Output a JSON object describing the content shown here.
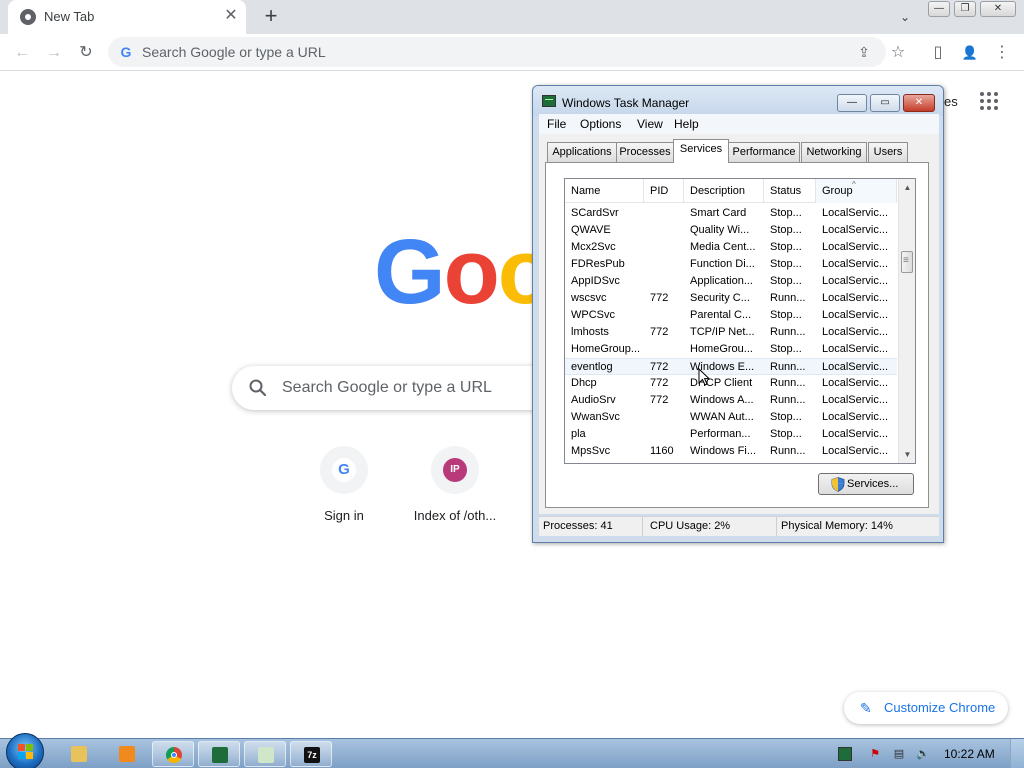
{
  "browser": {
    "tab": {
      "title": "New Tab",
      "close": "✕"
    },
    "new_tab": "+",
    "tab_search": "⌄",
    "window_controls": {
      "minimize": "—",
      "maximize": "❐",
      "close": "✕"
    },
    "nav": {
      "back": "←",
      "forward": "→",
      "reload": "↻"
    },
    "omnibox": {
      "placeholder": "Search Google or type a URL",
      "value": ""
    },
    "toolbar_icons": {
      "share": "⇪",
      "bookmark": "☆",
      "side_panel": "▯",
      "profile": "👤",
      "menu": "⋮"
    }
  },
  "ntp": {
    "logo_visible": [
      "G",
      "o",
      "o"
    ],
    "search": {
      "placeholder": "Search Google or type a URL",
      "value": ""
    },
    "shortcuts": [
      {
        "label": "Sign in",
        "icon": "G",
        "icon_name": "google-icon"
      },
      {
        "label": "Index of /oth...",
        "icon": "IP",
        "icon_name": "ip-icon"
      }
    ],
    "top_link_partial": "es",
    "customize_label": "Customize Chrome"
  },
  "task_manager": {
    "title": "Windows Task Manager",
    "controls": {
      "minimize": "—",
      "maximize": "▭",
      "close": "✕"
    },
    "menu": [
      "File",
      "Options",
      "View",
      "Help"
    ],
    "tabs": [
      "Applications",
      "Processes",
      "Services",
      "Performance",
      "Networking",
      "Users"
    ],
    "active_tab": "Services",
    "columns": [
      "Name",
      "PID",
      "Description",
      "Status",
      "Group"
    ],
    "sorted_column": "Group",
    "rows": [
      {
        "name": "SCardSvr",
        "pid": "",
        "description": "Smart Card",
        "status": "Stop...",
        "group": "LocalServic..."
      },
      {
        "name": "QWAVE",
        "pid": "",
        "description": "Quality Wi...",
        "status": "Stop...",
        "group": "LocalServic..."
      },
      {
        "name": "Mcx2Svc",
        "pid": "",
        "description": "Media Cent...",
        "status": "Stop...",
        "group": "LocalServic..."
      },
      {
        "name": "FDResPub",
        "pid": "",
        "description": "Function Di...",
        "status": "Stop...",
        "group": "LocalServic..."
      },
      {
        "name": "AppIDSvc",
        "pid": "",
        "description": "Application...",
        "status": "Stop...",
        "group": "LocalServic..."
      },
      {
        "name": "wscsvc",
        "pid": "772",
        "description": "Security C...",
        "status": "Runn...",
        "group": "LocalServic..."
      },
      {
        "name": "WPCSvc",
        "pid": "",
        "description": "Parental C...",
        "status": "Stop...",
        "group": "LocalServic..."
      },
      {
        "name": "lmhosts",
        "pid": "772",
        "description": "TCP/IP Net...",
        "status": "Runn...",
        "group": "LocalServic..."
      },
      {
        "name": "HomeGroup...",
        "pid": "",
        "description": "HomeGrou...",
        "status": "Stop...",
        "group": "LocalServic..."
      },
      {
        "name": "eventlog",
        "pid": "772",
        "description": "Windows E...",
        "status": "Runn...",
        "group": "LocalServic..."
      },
      {
        "name": "Dhcp",
        "pid": "772",
        "description": "DHCP Client",
        "status": "Runn...",
        "group": "LocalServic..."
      },
      {
        "name": "AudioSrv",
        "pid": "772",
        "description": "Windows A...",
        "status": "Runn...",
        "group": "LocalServic..."
      },
      {
        "name": "WwanSvc",
        "pid": "",
        "description": "WWAN Aut...",
        "status": "Stop...",
        "group": "LocalServic..."
      },
      {
        "name": "pla",
        "pid": "",
        "description": "Performan...",
        "status": "Stop...",
        "group": "LocalServic..."
      },
      {
        "name": "MpsSvc",
        "pid": "1160",
        "description": "Windows Fi...",
        "status": "Runn...",
        "group": "LocalServic..."
      }
    ],
    "hovered_row": "eventlog",
    "services_button": "Services...",
    "status_bar": {
      "processes": "Processes: 41",
      "cpu": "CPU Usage: 2%",
      "memory": "Physical Memory: 14%"
    }
  },
  "taskbar": {
    "clock": "10:22 AM",
    "apps": [
      {
        "name": "explorer",
        "icon_name": "folder-icon",
        "color": "#e8c25a"
      },
      {
        "name": "media-player",
        "icon_name": "media-player-icon",
        "color": "#f08a1c"
      },
      {
        "name": "chrome",
        "icon_name": "chrome-icon",
        "color": "#db4437"
      },
      {
        "name": "task-manager",
        "icon_name": "task-manager-icon",
        "color": "#1e6c3a"
      },
      {
        "name": "notepad",
        "icon_name": "notepad-icon",
        "color": "#cfe6c8"
      },
      {
        "name": "7-zip",
        "icon_name": "7zip-icon",
        "color": "#111111",
        "text": "7z"
      }
    ]
  }
}
